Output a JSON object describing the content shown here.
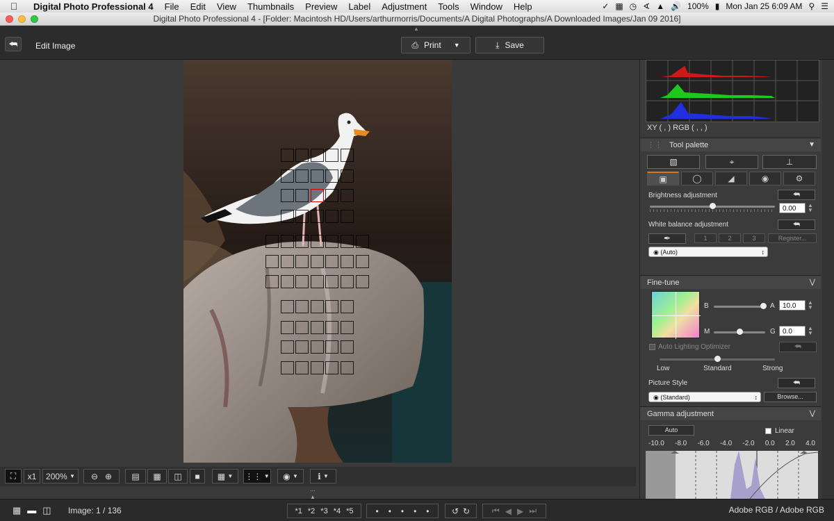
{
  "menubar": {
    "app_name": "Digital Photo Professional 4",
    "items": [
      "File",
      "Edit",
      "View",
      "Thumbnails",
      "Preview",
      "Label",
      "Adjustment",
      "Tools",
      "Window",
      "Help"
    ],
    "battery": "100%",
    "datetime": "Mon Jan 25  6:09 AM"
  },
  "window": {
    "title": "Digital Photo Professional 4 - [Folder: Macintosh HD/Users/arthurmorris/Documents/A Digital Photographs/A Downloaded Images/Jan 09 2016]"
  },
  "toolbar": {
    "mode_label": "Edit Image",
    "print_label": "Print",
    "save_label": "Save"
  },
  "viewbar": {
    "x1_label": "x1",
    "zoom": "200%"
  },
  "statusbar": {
    "image_counter": "Image: 1 / 136",
    "ratings": [
      "*1",
      "*2",
      "*3",
      "*4",
      "*5"
    ],
    "color_space": "Adobe RGB / Adobe RGB"
  },
  "panel": {
    "xy_readout": "XY (        ,        )  RGB (        ,        ,        )",
    "tool_palette_title": "Tool palette",
    "brightness": {
      "label": "Brightness adjustment",
      "value": "0.00",
      "level": 0.5
    },
    "white_balance": {
      "label": "White balance adjustment",
      "buttons": [
        "1",
        "2",
        "3"
      ],
      "register_label": "Register...",
      "selected": "(Auto)"
    },
    "finetune": {
      "title": "Fine-tune",
      "b_label": "B",
      "a_label": "A",
      "a_value": "10.0",
      "m_label": "M",
      "g_label": "G",
      "g_value": "0.0"
    },
    "alo": {
      "label": "Auto Lighting Optimizer",
      "levels": [
        "Low",
        "Standard",
        "Strong"
      ]
    },
    "picture_style": {
      "label": "Picture Style",
      "selected": "(Standard)",
      "browse_label": "Browse..."
    },
    "gamma": {
      "title": "Gamma adjustment",
      "auto_label": "Auto",
      "linear_label": "Linear",
      "scale": [
        "-10.0",
        "-8.0",
        "-6.0",
        "-4.0",
        "-2.0",
        "0.0",
        "2.0",
        "4.0"
      ]
    }
  },
  "colors": {
    "accent": "#d87a15",
    "hist_red": "#d01818",
    "hist_green": "#1ec81e",
    "hist_blue": "#2030e0"
  }
}
